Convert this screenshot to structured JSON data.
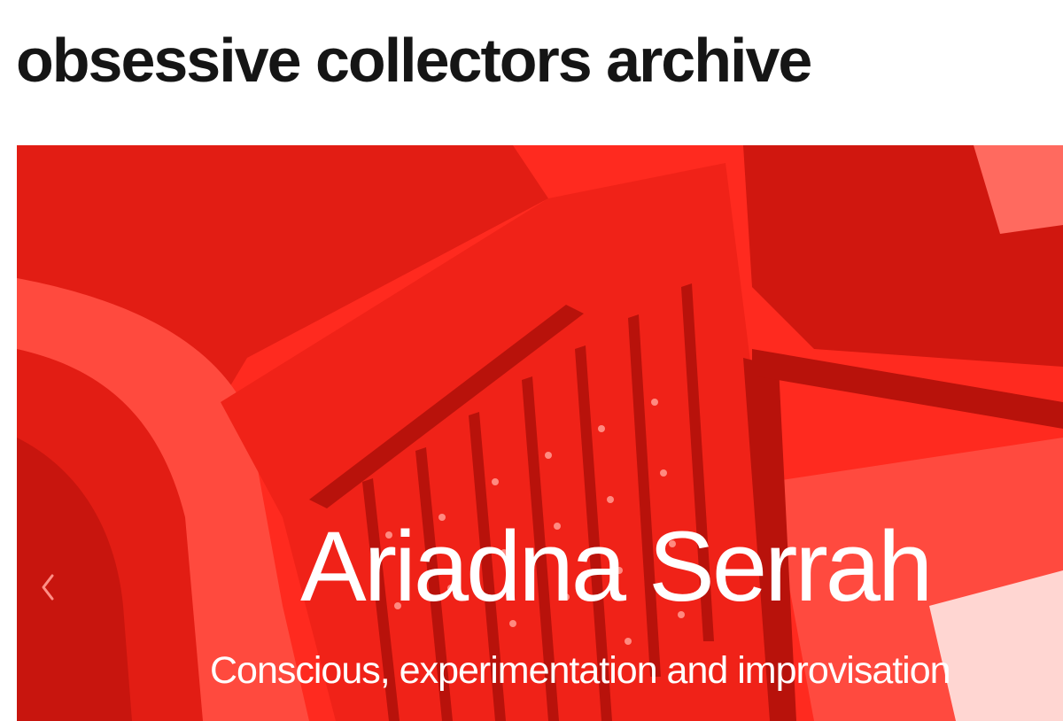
{
  "header": {
    "site_title": "obsessive collectors archive"
  },
  "slider": {
    "heading": "Ariadna Serrah",
    "subheading": "Conscious, experimentation and improvisation",
    "prev_icon": "chevron-left-icon",
    "image_subject": "red-tinted photo of a vintage machine",
    "tint_color": "#ff2a1f"
  }
}
